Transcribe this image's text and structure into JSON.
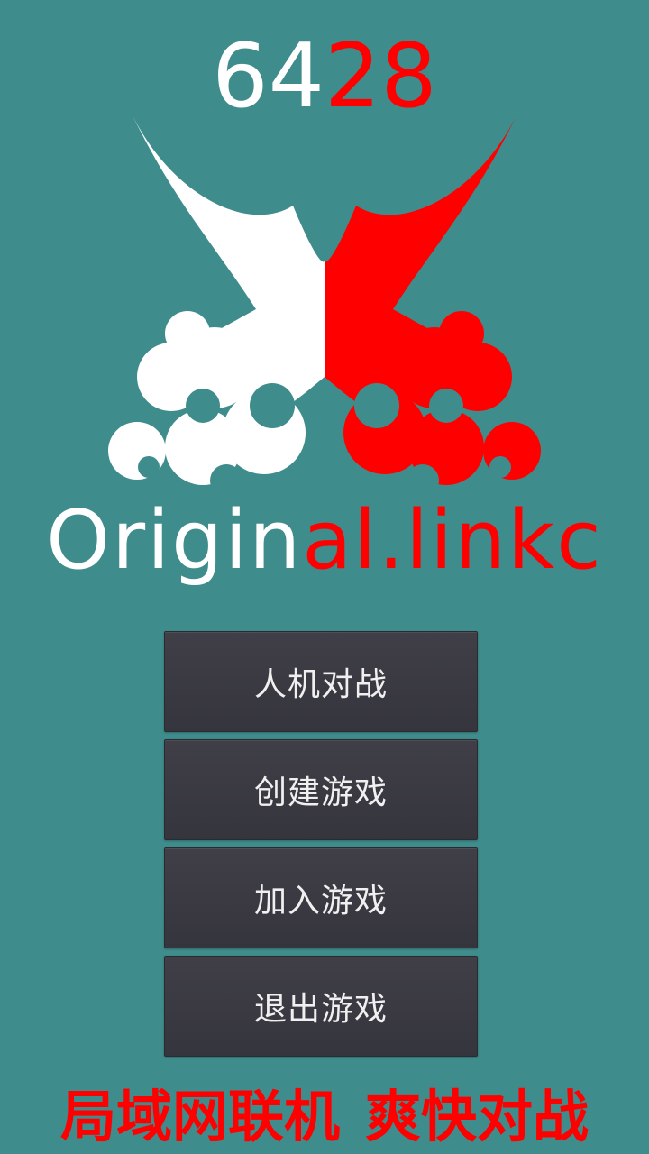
{
  "header": {
    "score_white": "64",
    "score_red": "28"
  },
  "logo": {
    "icon": "crossed-swords-icon",
    "white_color": "#FFFFFF",
    "red_color": "#FF0000"
  },
  "brand": {
    "white_part": "Origin",
    "red_part": "al.linkc"
  },
  "menu": {
    "items": [
      {
        "label": "人机对战"
      },
      {
        "label": "创建游戏"
      },
      {
        "label": "加入游戏"
      },
      {
        "label": "退出游戏"
      }
    ]
  },
  "footer": {
    "slogan_left": "局域网联机",
    "slogan_right": "爽快对战"
  },
  "colors": {
    "background": "#3F8C8C",
    "button": "#3A3A42",
    "accent": "#FF0000"
  }
}
